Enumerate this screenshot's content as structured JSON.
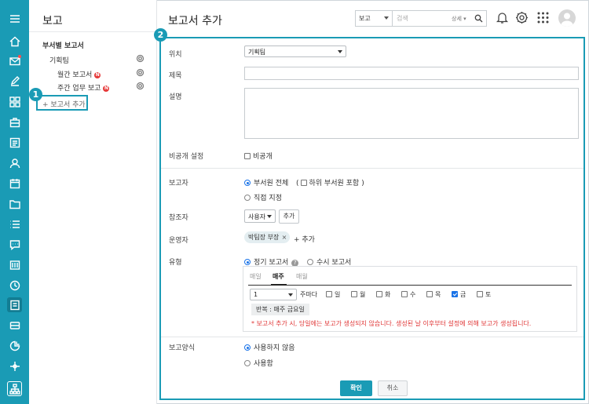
{
  "sidebar": {
    "title": "보고",
    "section_label": "부서별 보고서",
    "team": "기획팀",
    "reports": [
      {
        "label": "월간 보고서",
        "badge": "N"
      },
      {
        "label": "주간 업무 보고",
        "badge": "N"
      }
    ],
    "add_report_label": "+ 보고서 추가"
  },
  "markers": {
    "one": "1",
    "two": "2"
  },
  "header": {
    "title": "보고서 추가",
    "search_scope": "보고",
    "search_placeholder": "검색",
    "search_detail": "상세 ▾"
  },
  "form": {
    "location": {
      "label": "위치",
      "value": "기획팀"
    },
    "title": {
      "label": "제목",
      "value": ""
    },
    "description": {
      "label": "설명",
      "value": ""
    },
    "private": {
      "label": "비공개 설정",
      "option": "비공개",
      "checked": false
    },
    "reporter": {
      "label": "보고자",
      "options": [
        "부서원 전체",
        "직접 지정"
      ],
      "selected": "부서원 전체",
      "include_sub_label": "하위 부서원 포함",
      "include_sub_open": "(",
      "include_sub_close": ")"
    },
    "reference": {
      "label": "참조자",
      "select_value": "사용자",
      "add_label": "추가"
    },
    "operator": {
      "label": "운영자",
      "chip": "박팀장 부장",
      "chip_x": "×",
      "add_label": "+ 추가"
    },
    "type": {
      "label": "유형",
      "options": [
        "정기 보고서",
        "수시 보고서"
      ],
      "selected": "정기 보고서",
      "help": "?",
      "tabs": [
        "매일",
        "매주",
        "매월"
      ],
      "active_tab": "매주",
      "week_interval": "1",
      "every_week_label": "주마다",
      "days": [
        {
          "label": "일",
          "checked": false
        },
        {
          "label": "월",
          "checked": false
        },
        {
          "label": "화",
          "checked": false
        },
        {
          "label": "수",
          "checked": false
        },
        {
          "label": "목",
          "checked": false
        },
        {
          "label": "금",
          "checked": true
        },
        {
          "label": "토",
          "checked": false
        }
      ],
      "repeat_summary": "반복 : 매주 금요일",
      "notice": "* 보고서 추가 시, 당일에는 보고가 생성되지 않습니다. 생성된 날 이후부터 설정에 의해 보고가 생성됩니다."
    },
    "format": {
      "label": "보고양식",
      "options": [
        "사용하지 않음",
        "사용함"
      ],
      "selected": "사용하지 않음"
    },
    "confirm_label": "확인",
    "cancel_label": "취소"
  },
  "colors": {
    "accent": "#1a9bb5",
    "accent_dark": "#127d93",
    "notice": "#e03636",
    "badge": "#e63a3a"
  }
}
